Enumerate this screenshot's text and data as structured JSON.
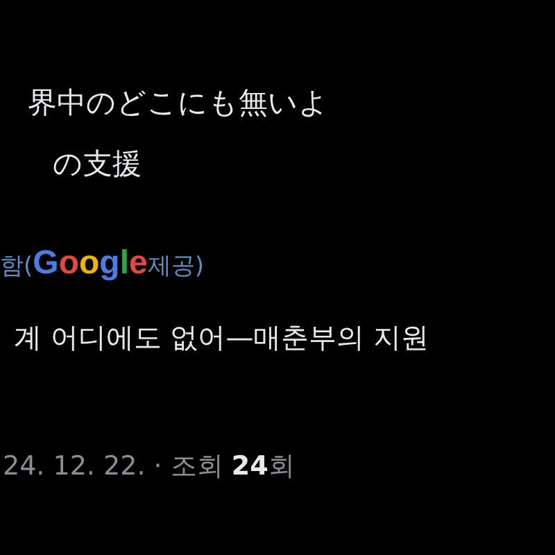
{
  "post": {
    "text_lines": [
      "界中のどこにも無いよ",
      "の支援"
    ],
    "translation": {
      "label_before": "함(",
      "logo": "Google",
      "label_after": " 제공)"
    },
    "translated_text": "계 어디에도 없어—매춘부의 지원",
    "meta": "24. 12. 22. · 조회 **24**회"
  }
}
